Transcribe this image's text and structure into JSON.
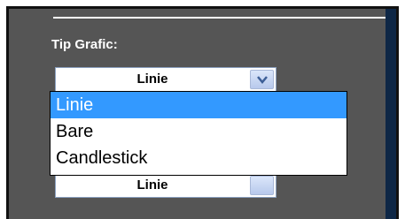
{
  "field": {
    "label": "Tip Grafic:",
    "selected_value": "Linie",
    "options": [
      "Linie",
      "Bare",
      "Candlestick"
    ],
    "highlighted_option": "Linie"
  },
  "second_field": {
    "selected_value": "Linie"
  },
  "colors": {
    "panel_bg": "#555555",
    "highlight": "#3399ff",
    "accent_bar": "#0e2746"
  }
}
